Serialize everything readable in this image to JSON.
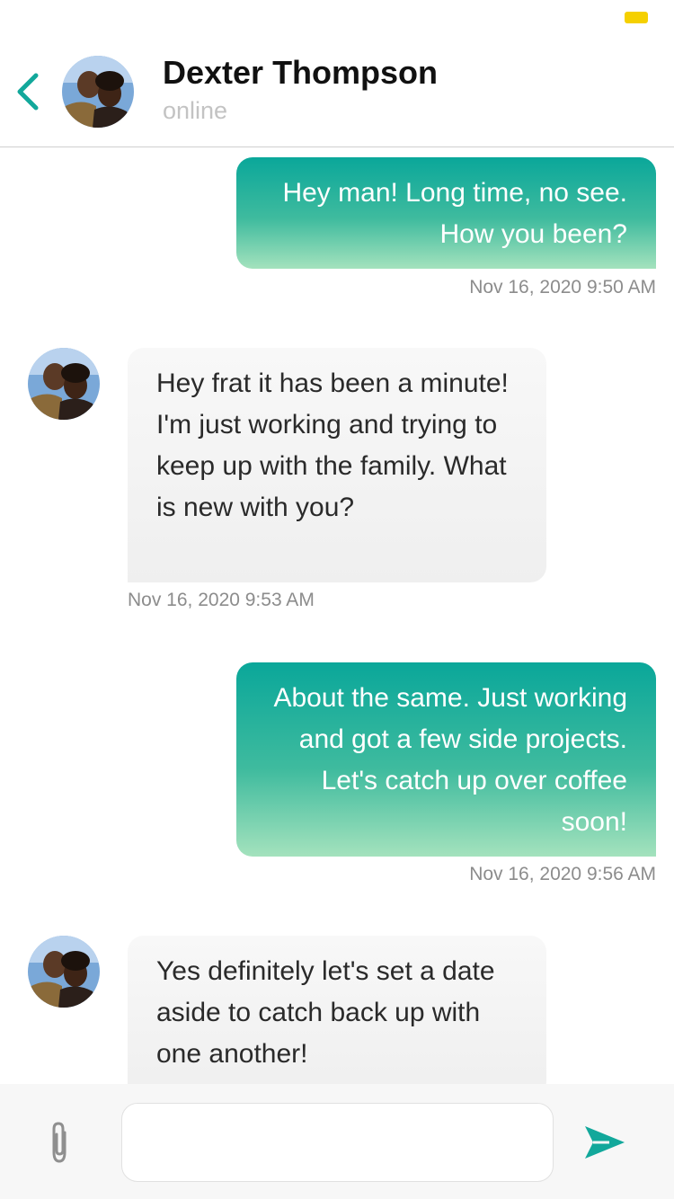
{
  "status_bar": {
    "battery_color": "#f5d000"
  },
  "header": {
    "back_icon": "chevron-left-icon",
    "contact_name": "Dexter Thompson",
    "status": "online"
  },
  "colors": {
    "accent": "#12a89b",
    "outgoing_gradient_top": "#0aa79a",
    "outgoing_gradient_bottom": "#a4e2bd"
  },
  "messages": [
    {
      "direction": "outgoing",
      "text": "Hey man! Long time, no see. How you been?",
      "time": "Nov 16, 2020 9:50 AM"
    },
    {
      "direction": "incoming",
      "text": "Hey frat it has been a minute! I'm just working and trying to keep up with the family. What is new with you?",
      "time": "Nov 16, 2020 9:53 AM"
    },
    {
      "direction": "outgoing",
      "text": "About the same. Just working and got a few side projects. Let's catch up over coffee soon!",
      "time": "Nov 16, 2020 9:56 AM"
    },
    {
      "direction": "incoming",
      "text": "Yes definitely let's set a date aside to catch back up with one another!"
    }
  ],
  "composer": {
    "attach_icon": "paperclip-icon",
    "input_value": "",
    "send_icon": "send-icon"
  }
}
